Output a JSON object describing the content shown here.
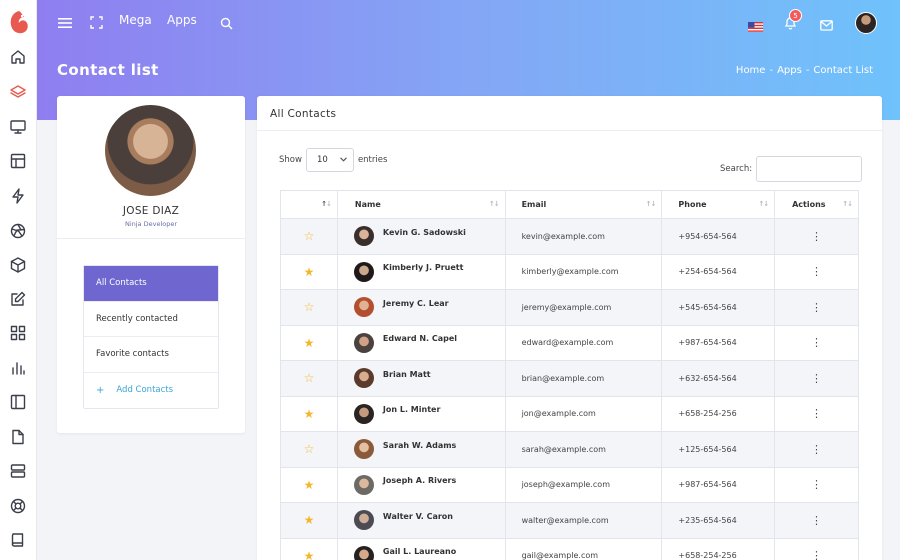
{
  "topbar": {
    "menu_mega": "Mega",
    "menu_apps": "Apps",
    "notification_count": "5"
  },
  "page": {
    "title": "Contact list",
    "breadcrumb": [
      "Home",
      "Apps",
      "Contact List"
    ],
    "breadcrumb_sep": "-"
  },
  "profile": {
    "name": "JOSE DIAZ",
    "role": "Ninja Developer",
    "menu": [
      "All Contacts",
      "Recently contacted",
      "Favorite contacts"
    ],
    "add_label": "Add Contacts",
    "add_icon": "+"
  },
  "contacts": {
    "title": "All Contacts",
    "show_label": "Show",
    "entries_value": "10",
    "entries_label": "entries",
    "search_label": "Search:",
    "search_value": "",
    "columns": [
      "Name",
      "Email",
      "Phone",
      "Actions"
    ],
    "rows": [
      {
        "name": "Kevin G. Sadowski",
        "email": "kevin@example.com",
        "phone": "+954-654-564",
        "fav": false
      },
      {
        "name": "Kimberly J. Pruett",
        "email": "kimberly@example.com",
        "phone": "+254-654-564",
        "fav": true
      },
      {
        "name": "Jeremy C. Lear",
        "email": "jeremy@example.com",
        "phone": "+545-654-564",
        "fav": false
      },
      {
        "name": "Edward N. Capel",
        "email": "edward@example.com",
        "phone": "+987-654-564",
        "fav": true
      },
      {
        "name": "Brian Matt",
        "email": "brian@example.com",
        "phone": "+632-654-564",
        "fav": false
      },
      {
        "name": "Jon L. Minter",
        "email": "jon@example.com",
        "phone": "+658-254-256",
        "fav": true
      },
      {
        "name": "Sarah W. Adams",
        "email": "sarah@example.com",
        "phone": "+125-654-564",
        "fav": false
      },
      {
        "name": "Joseph A. Rivers",
        "email": "joseph@example.com",
        "phone": "+987-654-564",
        "fav": true
      },
      {
        "name": "Walter V. Caron",
        "email": "walter@example.com",
        "phone": "+235-654-564",
        "fav": true
      },
      {
        "name": "Gail L. Laureano",
        "email": "gail@example.com",
        "phone": "+658-254-256",
        "fav": true
      }
    ]
  },
  "colors": {
    "accent": "#6f66cf",
    "star": "#f3b72c",
    "link": "#5a5fc8",
    "header_gradient": [
      "#8f7ef0",
      "#6fc2fb"
    ]
  },
  "icons": {
    "rail": [
      "home-icon",
      "layers-icon",
      "monitor-icon",
      "layout-icon",
      "zap-icon",
      "aperture-icon",
      "box-icon",
      "edit-icon",
      "grid-icon",
      "bar-chart-icon",
      "sidebar-icon",
      "file-icon",
      "server-icon",
      "life-buoy-icon",
      "book-icon"
    ],
    "star_on": "★",
    "star_off": "☆",
    "actions": "⋮"
  }
}
